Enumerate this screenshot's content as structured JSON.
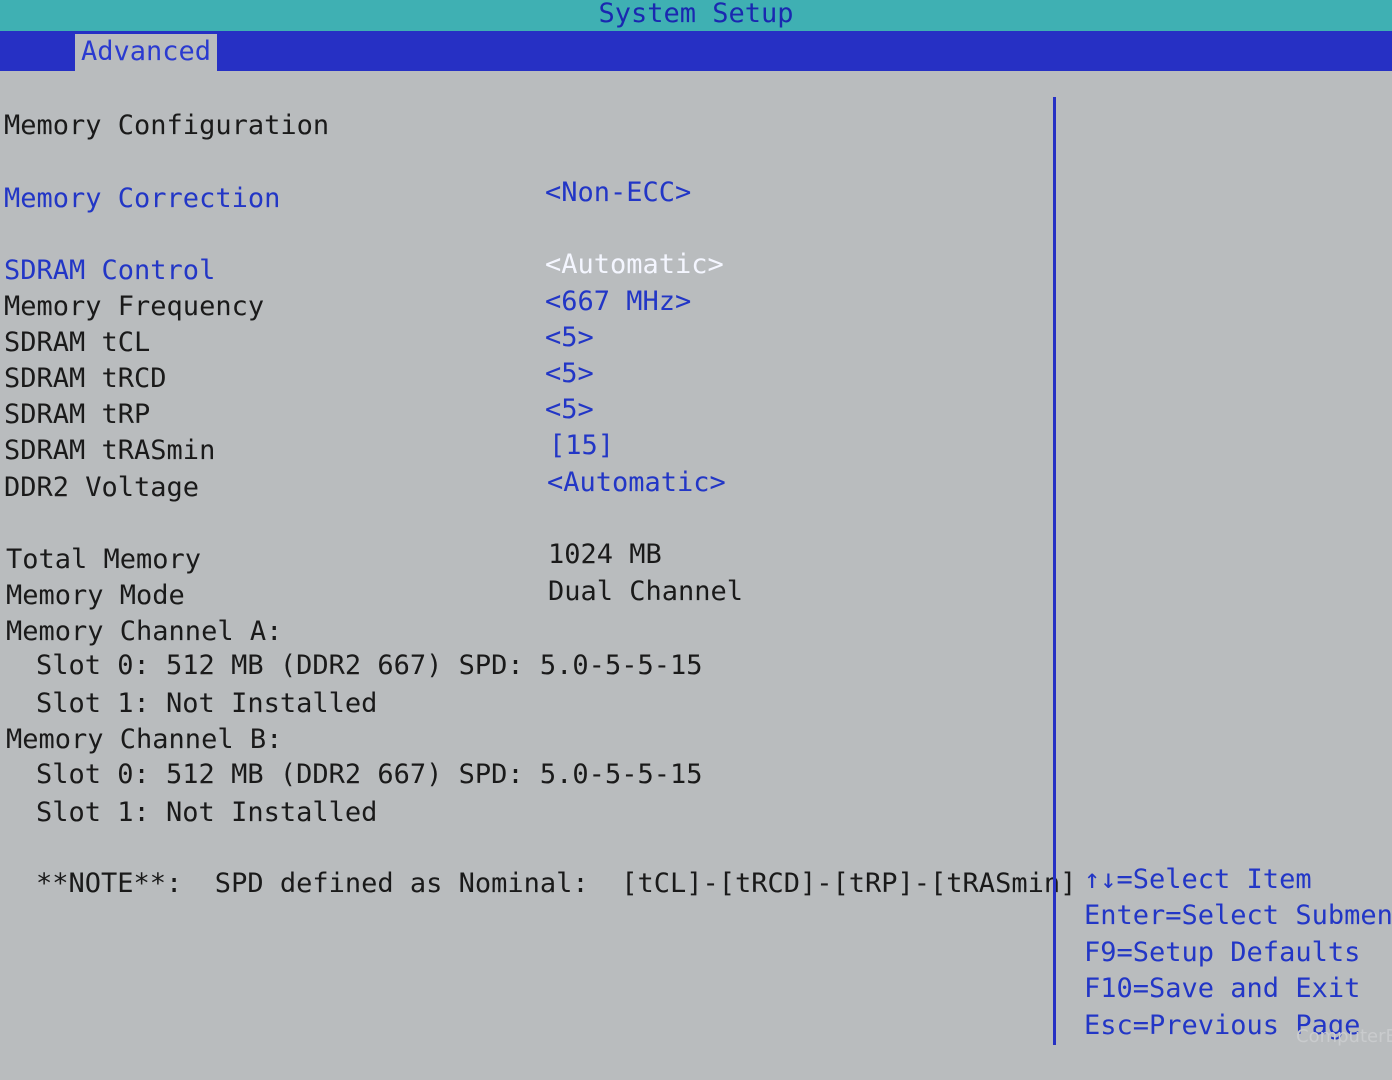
{
  "title": "System Setup",
  "tab": "Advanced",
  "section_title": "Memory Configuration",
  "settings": {
    "memory_correction": {
      "label": "Memory Correction",
      "value": "<Non-ECC>"
    },
    "sdram_control": {
      "label": "SDRAM Control",
      "value": "<Automatic>"
    },
    "memory_frequency": {
      "label": "Memory Frequency",
      "value": "<667 MHz>"
    },
    "sdram_tcl": {
      "label": "SDRAM tCL",
      "value": "<5>"
    },
    "sdram_trcd": {
      "label": "SDRAM tRCD",
      "value": "<5>"
    },
    "sdram_trp": {
      "label": "SDRAM tRP",
      "value": "<5>"
    },
    "sdram_trasmin": {
      "label": "SDRAM tRASmin",
      "value": "[15]"
    },
    "ddr2_voltage": {
      "label": "DDR2 Voltage",
      "value": "<Automatic>"
    }
  },
  "info": {
    "total_memory": {
      "label": "Total Memory",
      "value": "1024 MB"
    },
    "memory_mode": {
      "label": "Memory Mode",
      "value": "Dual Channel"
    },
    "channel_a": {
      "label": "Memory Channel A:",
      "slot0": "Slot 0: 512 MB (DDR2 667) SPD: 5.0-5-5-15",
      "slot1": "Slot 1: Not Installed"
    },
    "channel_b": {
      "label": "Memory Channel B:",
      "slot0": "Slot 0: 512 MB (DDR2 667) SPD: 5.0-5-5-15",
      "slot1": "Slot 1: Not Installed"
    }
  },
  "note": "**NOTE**:  SPD defined as Nominal:  [tCL]-[tRCD]-[tRP]-[tRASmin]",
  "help": {
    "select_item": "↑↓=Select Item",
    "enter": "Enter=Select Submenu",
    "f9": "F9=Setup Defaults",
    "f10": "F10=Save and Exit",
    "esc": "Esc=Previous Page"
  },
  "watermark": "ComputerBase",
  "colors": {
    "background": "#b9bcbe",
    "title_bar": "#3fb0b3",
    "tab_bar": "#2630c4",
    "highlight_text": "#2236c6",
    "selected_text": "#f4f6ff"
  }
}
